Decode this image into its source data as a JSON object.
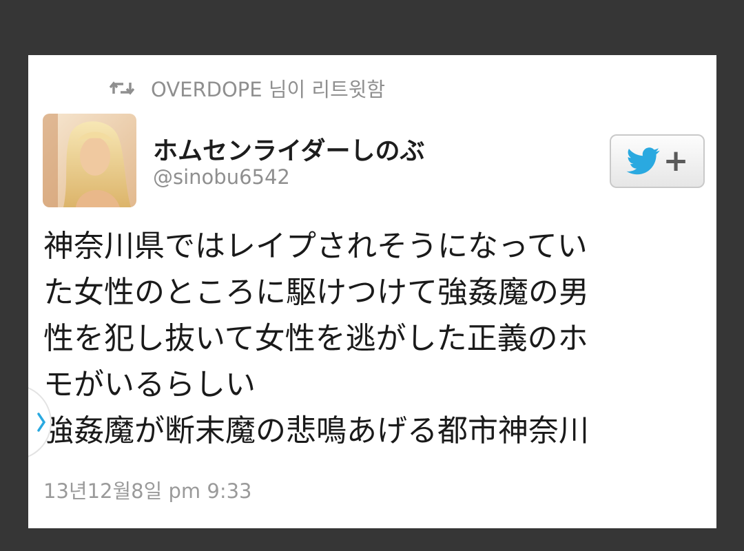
{
  "retweet": {
    "icon": "retweet-icon",
    "text": "OVERDOPE 님이 리트윗함"
  },
  "author": {
    "display_name": "ホムセンライダーしのぶ",
    "handle": "@sinobu6542",
    "avatar": "profile-photo"
  },
  "follow_button": {
    "icon": "twitter-bird-icon",
    "plus": "+",
    "color": "#2aa9e0"
  },
  "tweet": {
    "lines": [
      "神奈川県ではレイプされそうになってい",
      "た女性のところに駆けつけて強姦魔の男",
      "性を犯し抜いて女性を逃がした正義のホ",
      "モがいるらしい",
      "強姦魔が断末魔の悲鳴あげる都市神奈川"
    ]
  },
  "timestamp": "13년12월8일 pm 9:33",
  "colors": {
    "background": "#363636",
    "card": "#ffffff",
    "secondary_text": "#8f8f8f"
  }
}
